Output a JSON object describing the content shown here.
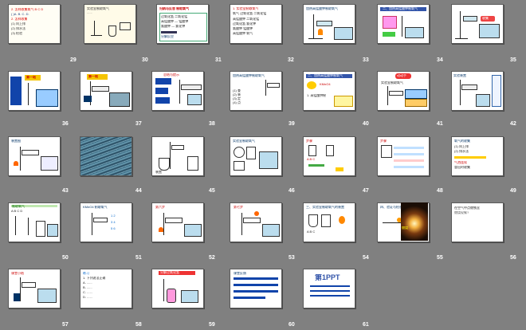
{
  "slides": [
    {
      "num": "29",
      "text": "2. 怎样收集氧气 B C D"
    },
    {
      "num": "30",
      "text": "实验室制取氧气"
    },
    {
      "num": "31",
      "text": "归纳与反思 制取氧气"
    },
    {
      "num": "32",
      "text": "氧气 过氧化氢 二氧化锰"
    },
    {
      "num": "33",
      "text": "加热高锰酸钾制取氧气"
    },
    {
      "num": "34",
      "text": "二、加热高锰酸钾制氧气"
    },
    {
      "num": "35",
      "text": "收集"
    },
    {
      "num": "36",
      "text": "第一站"
    },
    {
      "num": "37",
      "text": "第一站"
    },
    {
      "num": "38",
      "text": "总结与提示"
    },
    {
      "num": "39",
      "text": "加热高锰酸钾制取氧气"
    },
    {
      "num": "40",
      "text": "二、加热高锰酸钾制氧气"
    },
    {
      "num": "41",
      "text": "动动手"
    },
    {
      "num": "42",
      "text": "实验装置"
    },
    {
      "num": "43",
      "text": "装置图"
    },
    {
      "num": "44",
      "text": ""
    },
    {
      "num": "45",
      "text": "装置"
    },
    {
      "num": "46",
      "text": "实验室制取氧气"
    },
    {
      "num": "47",
      "text": "步骤"
    },
    {
      "num": "48",
      "text": "步骤"
    },
    {
      "num": "49",
      "text": "氧气的收集"
    },
    {
      "num": "50",
      "text": "制取氧气"
    },
    {
      "num": "51",
      "text": "KMnO4 制取氧气"
    },
    {
      "num": "52",
      "text": "第六步"
    },
    {
      "num": "53",
      "text": "第七步"
    },
    {
      "num": "54",
      "text": "三、实验室制取氧气的装置"
    },
    {
      "num": "55",
      "text": "四、验证与检验"
    },
    {
      "num": "56",
      "text": "在空气中点燃铁丝"
    },
    {
      "num": "57",
      "text": "课堂小结"
    },
    {
      "num": "58",
      "text": "练习"
    },
    {
      "num": "59",
      "text": "分解过氧化氢"
    },
    {
      "num": "60",
      "text": "课堂反馈"
    },
    {
      "num": "61",
      "text": "第1PPT"
    }
  ],
  "colors": {
    "background": "#808080",
    "number": "#ffffff"
  }
}
